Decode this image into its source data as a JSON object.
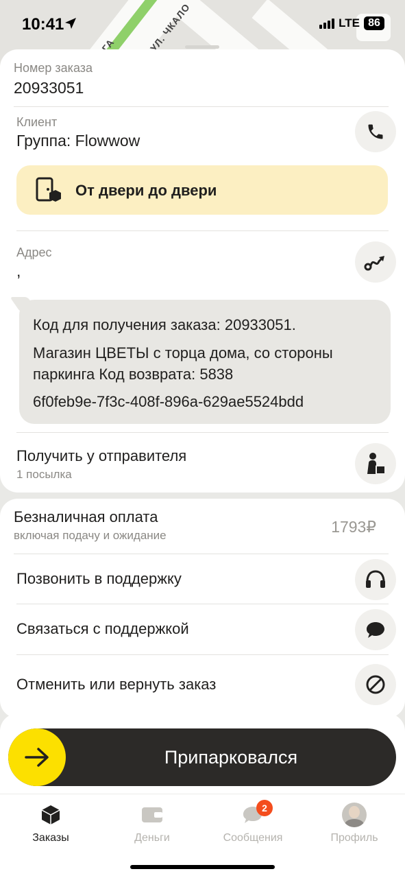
{
  "status_bar": {
    "time": "10:41",
    "network": "LTE",
    "battery": "86"
  },
  "map": {
    "street_1": "УЛ. ЧКАЛО",
    "street_2": "ГА"
  },
  "order": {
    "number_label": "Номер заказа",
    "number_value": "20933051",
    "client_label": "Клиент",
    "client_value": "Группа: Flowwow",
    "door_to_door": "От двери до двери",
    "address_label": "Адрес",
    "address_value": ",",
    "comment_lines": [
      "Код для получения заказа: 20933051.",
      "Магазин ЦВЕТЫ с торца дома, со стороны",
      "паркинга Код возврата: 5838",
      "6f0feb9e-7f3c-408f-896a-629ae5524bdd"
    ],
    "pickup_title": "Получить у отправителя",
    "pickup_sub": "1 посылка"
  },
  "payment": {
    "title": "Безналичная оплата",
    "subtitle": "включая подачу и ожидание",
    "amount": "1793₽"
  },
  "actions": {
    "call_support": "Позвонить в поддержку",
    "chat_support": "Связаться с поддержкой",
    "cancel_return": "Отменить или вернуть заказ"
  },
  "slider": {
    "label": "Припарковался"
  },
  "tabs": [
    {
      "label": "Заказы",
      "active": true
    },
    {
      "label": "Деньги",
      "active": false
    },
    {
      "label": "Сообщения",
      "active": false,
      "badge": "2"
    },
    {
      "label": "Профиль",
      "active": false
    }
  ],
  "colors": {
    "accent_yellow": "#fce000",
    "banner_bg": "#fcefc2",
    "badge_red": "#f44d1d"
  }
}
